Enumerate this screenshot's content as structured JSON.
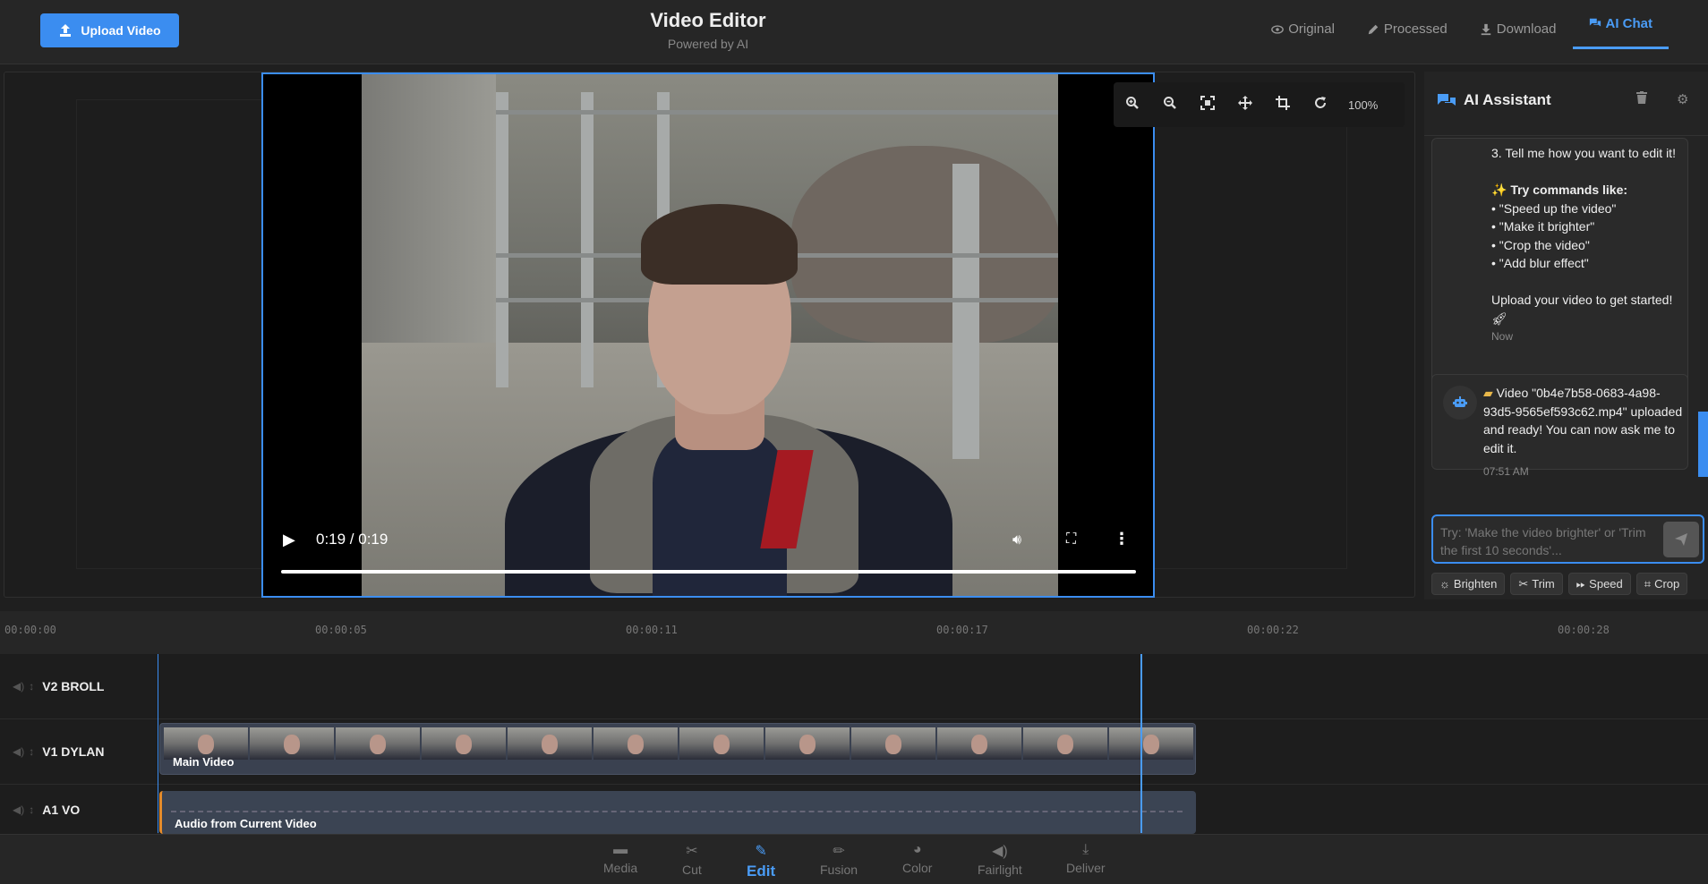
{
  "header": {
    "upload_label": "Upload Video",
    "title": "Video Editor",
    "subtitle": "Powered by AI",
    "nav": [
      {
        "label": "Original",
        "icon": "eye-icon"
      },
      {
        "label": "Processed",
        "icon": "pencil-icon"
      },
      {
        "label": "Download",
        "icon": "download-icon"
      },
      {
        "label": "AI Chat",
        "icon": "chat-icon",
        "active": true
      }
    ]
  },
  "player": {
    "time": "0:19 / 0:19",
    "progress": 1.0
  },
  "tools": {
    "zoom": "100%"
  },
  "ai": {
    "title": "AI Assistant",
    "msg1": {
      "step3": "3. Tell me how you want to edit it!",
      "try_heading": "Try commands like:",
      "cmds": [
        "• \"Speed up the video\"",
        "• \"Make it brighter\"",
        "• \"Crop the video\"",
        "• \"Add blur effect\""
      ],
      "closing": "Upload your video to get started!",
      "time": "Now"
    },
    "msg2": {
      "text": "Video \"0b4e7b58-0683-4a98-93d5-9565ef593c62.mp4\" uploaded and ready! You can now ask me to edit it.",
      "time": "07:51 AM"
    },
    "input_placeholder": "Try: 'Make the video brighter' or 'Trim the first 10 seconds'...",
    "chips": [
      "Brighten",
      "Trim",
      "Speed",
      "Crop"
    ]
  },
  "timeline": {
    "ticks": [
      "00:00:00",
      "00:00:05",
      "00:00:11",
      "00:00:17",
      "00:00:22",
      "00:00:28"
    ],
    "tracks": [
      {
        "name": "V2 BROLL"
      },
      {
        "name": "V1 DYLAN",
        "clip": "Main Video"
      },
      {
        "name": "A1 VO",
        "clip": "Audio from Current Video"
      }
    ]
  },
  "bottom_nav": [
    "Media",
    "Cut",
    "Edit",
    "Fusion",
    "Color",
    "Fairlight",
    "Deliver"
  ],
  "colors": {
    "accent": "#3b8df0",
    "audio_clip_edge": "#e58b2a"
  }
}
